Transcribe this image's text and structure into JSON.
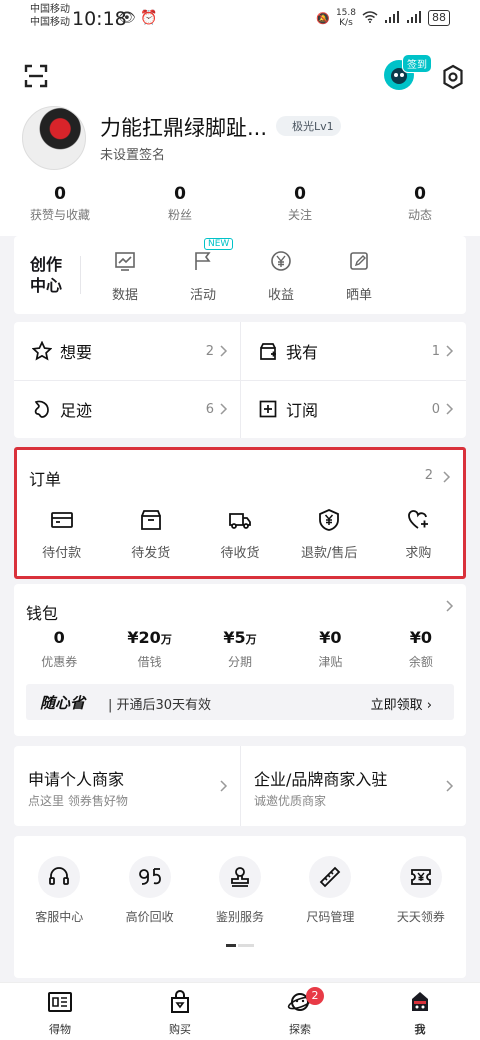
{
  "status_bar": {
    "carrier1": "中国移动",
    "carrier2": "中国移动",
    "time": "10:18",
    "speed_value": "15.8",
    "speed_unit": "K/s",
    "battery": "88"
  },
  "header": {
    "checkin_label": "签到",
    "username": "力能扛鼎绿脚趾...",
    "level": "极光Lv1",
    "signature": "未设置签名",
    "stats": [
      {
        "value": "0",
        "label": "获赞与收藏"
      },
      {
        "value": "0",
        "label": "粉丝"
      },
      {
        "value": "0",
        "label": "关注"
      },
      {
        "value": "0",
        "label": "动态"
      }
    ]
  },
  "creator": {
    "title": "创作中心",
    "items": [
      {
        "label": "数据",
        "icon": "chart-icon"
      },
      {
        "label": "活动",
        "icon": "flag-icon",
        "badge": "NEW"
      },
      {
        "label": "收益",
        "icon": "yuan-icon"
      },
      {
        "label": "晒单",
        "icon": "edit-icon"
      }
    ]
  },
  "wants": [
    {
      "label": "想要",
      "count": "2",
      "icon": "star-icon"
    },
    {
      "label": "我有",
      "count": "1",
      "icon": "box-plus-icon"
    },
    {
      "label": "足迹",
      "count": "6",
      "icon": "footprint-icon"
    },
    {
      "label": "订阅",
      "count": "0",
      "icon": "square-plus-icon"
    }
  ],
  "orders": {
    "title": "订单",
    "count": "2",
    "items": [
      {
        "label": "待付款",
        "icon": "card-icon"
      },
      {
        "label": "待发货",
        "icon": "package-icon"
      },
      {
        "label": "待收货",
        "icon": "truck-icon"
      },
      {
        "label": "退款/售后",
        "icon": "shield-yuan-icon"
      },
      {
        "label": "求购",
        "icon": "heart-plus-icon"
      }
    ]
  },
  "wallet": {
    "title": "钱包",
    "items": [
      {
        "value": "0",
        "unit": "",
        "label": "优惠券"
      },
      {
        "value": "¥20",
        "unit": "万",
        "label": "借钱"
      },
      {
        "value": "¥5",
        "unit": "万",
        "label": "分期"
      },
      {
        "value": "¥0",
        "unit": "",
        "label": "津贴"
      },
      {
        "value": "¥0",
        "unit": "",
        "label": "余额"
      }
    ],
    "promo_brand": "随心省",
    "promo_text": "| 开通后30天有效",
    "promo_cta": "立即领取"
  },
  "merchant": [
    {
      "title": "申请个人商家",
      "subtitle": "点这里 领券售好物"
    },
    {
      "title": "企业/品牌商家入驻",
      "subtitle": "诚邀优质商家"
    }
  ],
  "services": [
    {
      "label": "客服中心",
      "icon": "headset-icon"
    },
    {
      "label": "高价回收",
      "icon": "recycle-95-icon"
    },
    {
      "label": "鉴别服务",
      "icon": "stamp-icon"
    },
    {
      "label": "尺码管理",
      "icon": "ruler-icon"
    },
    {
      "label": "天天领券",
      "icon": "ticket-icon"
    }
  ],
  "tabbar": [
    {
      "label": "得物",
      "icon": "dewu-icon"
    },
    {
      "label": "购买",
      "icon": "bag-icon"
    },
    {
      "label": "探索",
      "icon": "planet-icon",
      "badge": "2"
    },
    {
      "label": "我",
      "icon": "me-avatar-icon"
    }
  ]
}
